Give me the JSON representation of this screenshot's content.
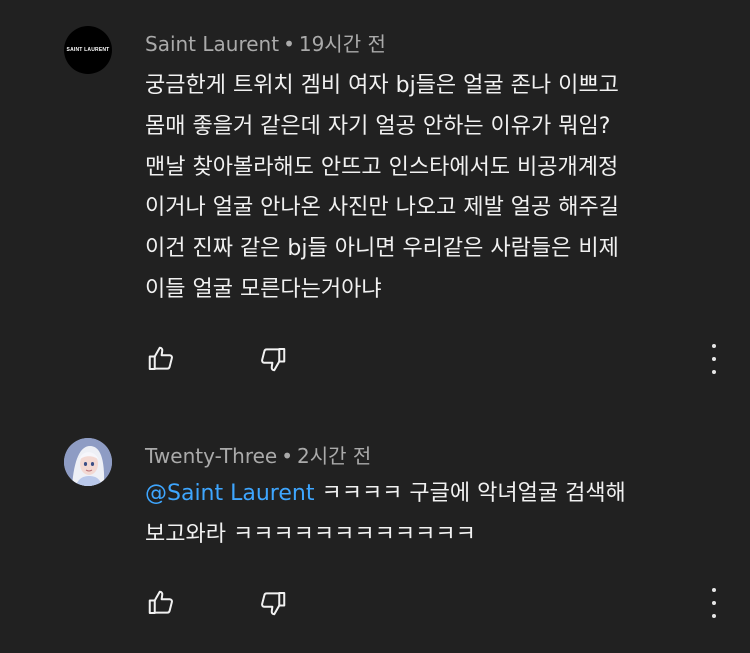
{
  "comments": [
    {
      "author": "Saint Laurent",
      "time": "19시간 전",
      "avatar_text": "SAINT LAURENT",
      "text": "궁금한게 트위치 겜비 여자 bj들은 얼굴 존나 이쁘고\n몸매 좋을거 같은데 자기 얼공 안하는 이유가 뭐임?\n맨날 찾아볼라해도 안뜨고 인스타에서도 비공개계정\n이거나 얼굴 안나온 사진만 나오고 제발 얼공 해주길\n이건 진짜 같은 bj들 아니면 우리같은 사람들은 비제\n이들 얼굴 모른다는거아냐"
    },
    {
      "author": "Twenty-Three",
      "time": "2시간 전",
      "mention": "@Saint Laurent",
      "text": " ㅋㅋㅋㅋ 구글에 악녀얼굴 검색해\n보고와라 ㅋㅋㅋㅋㅋㅋㅋㅋㅋㅋㅋㅋ"
    }
  ],
  "separator": "•",
  "icons": [
    "thumb-up-icon",
    "thumb-down-icon",
    "more-vert-icon"
  ]
}
